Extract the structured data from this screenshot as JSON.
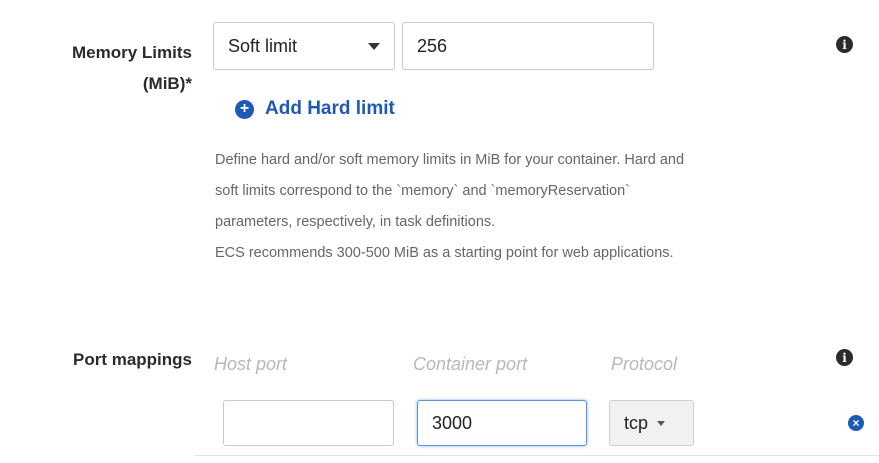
{
  "memory": {
    "label_line1": "Memory Limits",
    "label_line2": "(MiB)*",
    "limit_type": "Soft limit",
    "value": "256",
    "add_hard_label": "Add Hard limit",
    "help_lines": [
      "Define hard and/or soft memory limits in MiB for your container. Hard and",
      "soft limits correspond to the `memory` and `memoryReservation`",
      "parameters, respectively, in task definitions.",
      "ECS recommends 300-500 MiB as a starting point for web applications."
    ]
  },
  "ports": {
    "label": "Port mappings",
    "headers": {
      "host": "Host port",
      "container": "Container port",
      "protocol": "Protocol"
    },
    "row": {
      "host_value": "",
      "container_value": "3000",
      "protocol": "tcp"
    }
  },
  "icons": {
    "info": "info-circle-icon",
    "plus": "plus-circle-icon",
    "remove": "remove-circle-icon",
    "accent": "#1f59b8"
  }
}
